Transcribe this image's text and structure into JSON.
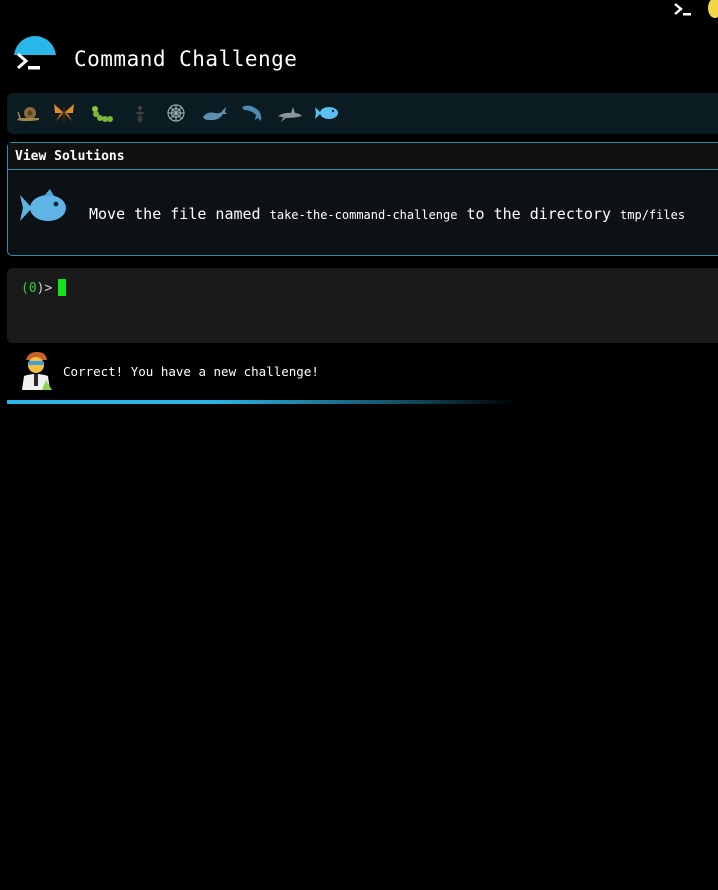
{
  "app": {
    "title": "Command Challenge"
  },
  "levels": {
    "items": [
      {
        "name": "snail-icon"
      },
      {
        "name": "butterfly-icon"
      },
      {
        "name": "caterpillar-icon"
      },
      {
        "name": "ant-icon"
      },
      {
        "name": "spider-web-icon"
      },
      {
        "name": "whale-icon"
      },
      {
        "name": "dolphin-icon"
      },
      {
        "name": "shark-icon"
      },
      {
        "name": "fish-icon"
      }
    ],
    "current_index": 8
  },
  "challenge": {
    "view_solutions_label": "View Solutions",
    "prefix": "Move the file named",
    "file": "take-the-command-challenge",
    "middle": "to the directory",
    "directory": "tmp/files"
  },
  "terminal": {
    "prompt_open": "(",
    "prompt_number": "0",
    "prompt_close": ")>"
  },
  "feedback": {
    "message": "Correct! You have a new challenge!"
  },
  "colors": {
    "accent": "#29b6e8",
    "prompt_green": "#2fd02f",
    "cursor": "#15e315"
  }
}
